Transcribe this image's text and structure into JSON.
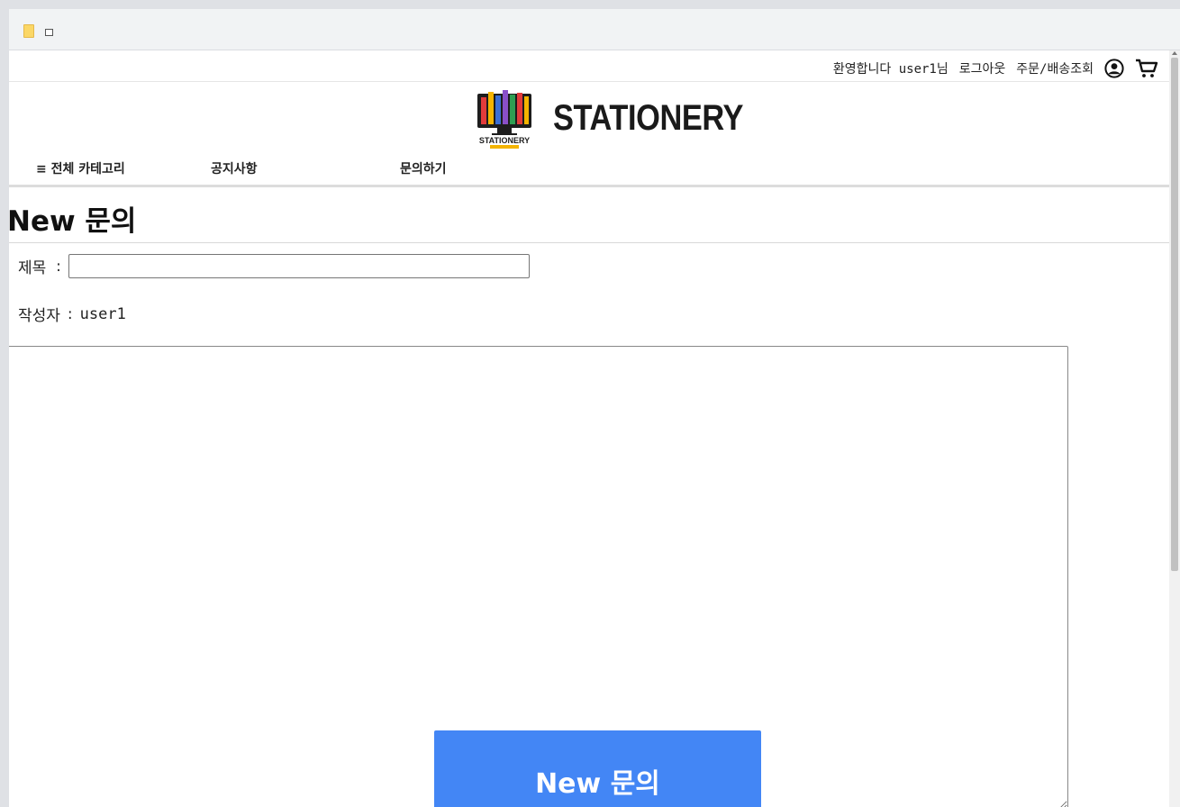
{
  "bookmarks": {
    "folder_icon": "folder-icon",
    "page_icon": "page-icon"
  },
  "util_bar": {
    "welcome": "환영합니다 user1님",
    "logout": "로그아웃",
    "order_lookup": "주문/배송조회",
    "user_icon": "user-circle-icon",
    "cart_icon": "cart-icon"
  },
  "header": {
    "brand_name": "STATIONERY",
    "logo_text": "STATIONERY",
    "logo_colors": [
      "#e23b3b",
      "#f4b400",
      "#3b6fd4",
      "#8a4fc9",
      "#2e9e52"
    ]
  },
  "nav": {
    "all_categories": "≡ 전체 카테고리",
    "notice": "공지사항",
    "inquiry": "문의하기"
  },
  "form": {
    "page_title": "New 문의",
    "title_label": "제목  ",
    "title_colon": ":",
    "title_value": "",
    "writer_label": "작성자",
    "writer_colon": ":",
    "writer_value": "user1",
    "content_value": "",
    "submit_label": "New 문의",
    "accent_color": "#4386f5"
  }
}
